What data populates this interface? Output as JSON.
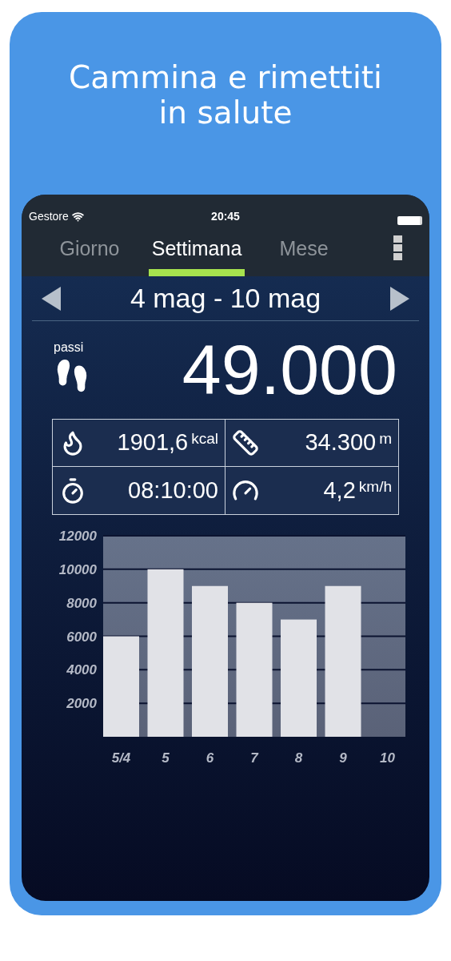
{
  "headline": "Cammina e rimettiti in salute",
  "status_bar": {
    "carrier": "Gestore",
    "time": "20:45"
  },
  "tabs": [
    {
      "label": "Giorno",
      "selected": false
    },
    {
      "label": "Settimana",
      "selected": true
    },
    {
      "label": "Mese",
      "selected": false
    }
  ],
  "period": {
    "label": "4 mag - 10 mag"
  },
  "steps": {
    "label": "passi",
    "value": "49.000"
  },
  "stats": [
    {
      "kind": "calories",
      "value": "1901,6",
      "unit": "kcal"
    },
    {
      "kind": "distance",
      "value": "34.300",
      "unit": "m"
    },
    {
      "kind": "duration",
      "value": "08:10:00"
    },
    {
      "kind": "speed",
      "value": "4,2",
      "unit": "km/h"
    }
  ],
  "chart_data": {
    "type": "bar",
    "categories": [
      "5/4",
      "5",
      "6",
      "7",
      "8",
      "9",
      "10"
    ],
    "values": [
      6000,
      10000,
      9000,
      8000,
      7000,
      9000,
      null
    ],
    "ylim": [
      0,
      12000
    ],
    "grid": true,
    "yticks": [
      2000,
      4000,
      6000,
      8000,
      10000,
      12000
    ]
  }
}
